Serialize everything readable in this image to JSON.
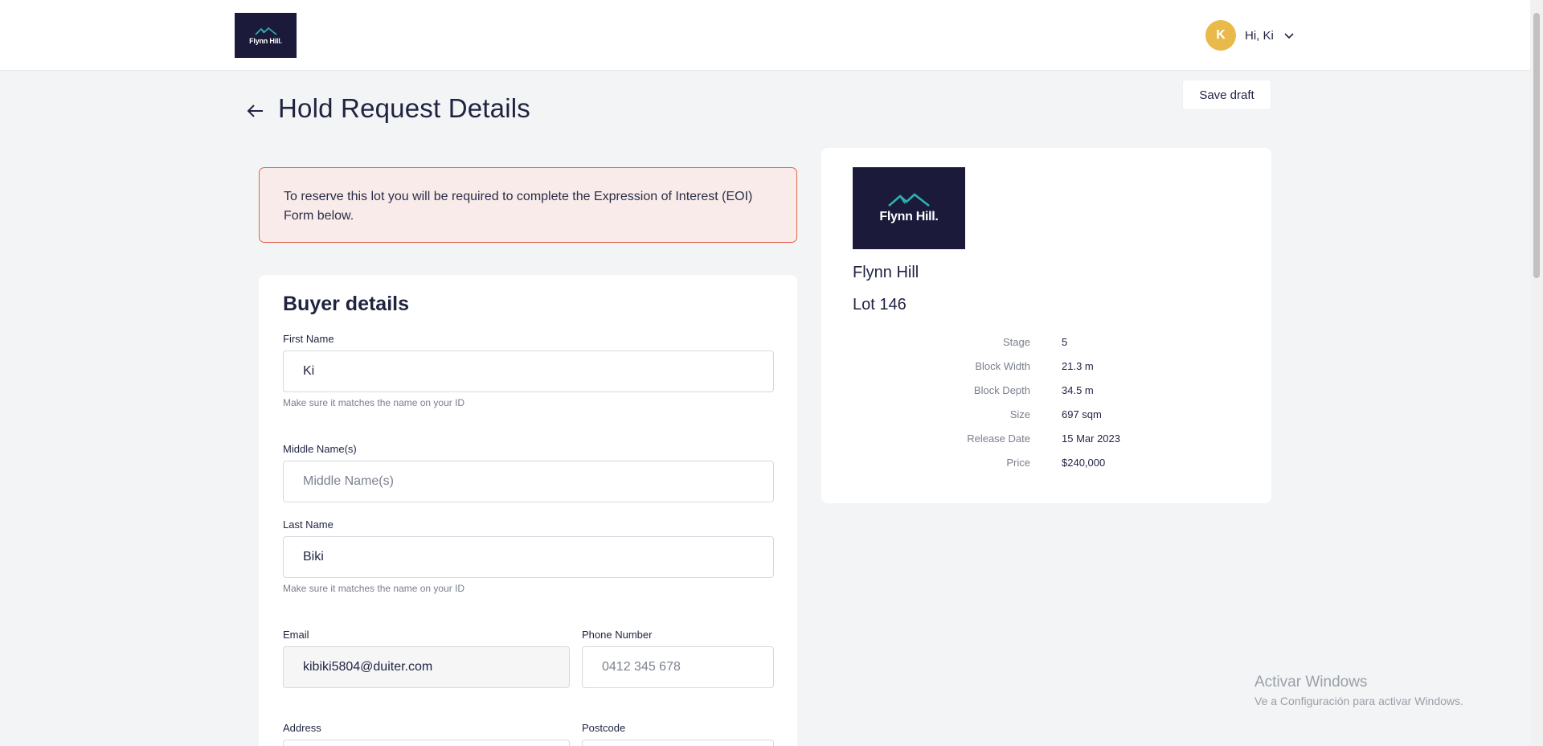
{
  "header": {
    "logo_text": "Flynn Hill.",
    "avatar_initial": "K",
    "greeting": "Hi, Ki"
  },
  "page": {
    "title": "Hold Request Details",
    "save_draft_label": "Save draft"
  },
  "alert": {
    "message": "To reserve this lot you will be required to complete the Expression of Interest (EOI) Form below."
  },
  "buyer_details": {
    "title": "Buyer details",
    "first_name": {
      "label": "First Name",
      "value": "Ki",
      "hint": "Make sure it matches the name on your ID"
    },
    "middle_name": {
      "label": "Middle Name(s)",
      "value": "",
      "placeholder": "Middle Name(s)"
    },
    "last_name": {
      "label": "Last Name",
      "value": "Biki",
      "hint": "Make sure it matches the name on your ID"
    },
    "email": {
      "label": "Email",
      "value": "kibiki5804@duiter.com"
    },
    "phone": {
      "label": "Phone Number",
      "value": "",
      "placeholder": "0412 345 678"
    },
    "address": {
      "label": "Address"
    },
    "postcode": {
      "label": "Postcode"
    }
  },
  "lot": {
    "logo_text": "Flynn Hill.",
    "estate_name": "Flynn Hill",
    "lot_name": "Lot 146",
    "details": [
      {
        "label": "Stage",
        "value": "5"
      },
      {
        "label": "Block Width",
        "value": "21.3 m"
      },
      {
        "label": "Block Depth",
        "value": "34.5 m"
      },
      {
        "label": "Size",
        "value": "697 sqm"
      },
      {
        "label": "Release Date",
        "value": "15 Mar 2023"
      },
      {
        "label": "Price",
        "value": "$240,000"
      }
    ]
  },
  "watermark": {
    "title": "Activar Windows",
    "subtitle": "Ve a Configuración para activar Windows."
  },
  "colors": {
    "brand_navy": "#1b1a3a",
    "logo_accent": "#2bb3b1",
    "avatar": "#e9b949",
    "alert_border": "#e2644a",
    "alert_bg": "#f8ebea",
    "page_bg": "#f3f4f6"
  }
}
